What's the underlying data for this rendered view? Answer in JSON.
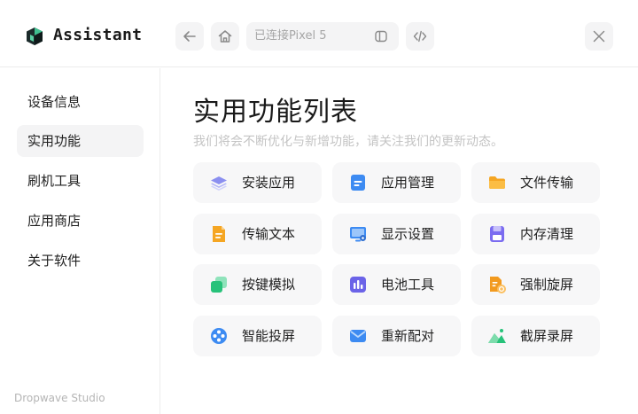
{
  "app": {
    "name": "Assistant",
    "device_status": "已连接Pixel 5",
    "footer": "Dropwave Studio"
  },
  "toolbar": {
    "back_icon": "arrow-left-icon",
    "home_icon": "home-icon",
    "device_panel_icon": "sidebar-panel-icon",
    "code_icon": "code-icon",
    "close_icon": "close-icon"
  },
  "sidebar": {
    "items": [
      {
        "label": "设备信息",
        "active": false
      },
      {
        "label": "实用功能",
        "active": true
      },
      {
        "label": "刷机工具",
        "active": false
      },
      {
        "label": "应用商店",
        "active": false
      },
      {
        "label": "关于软件",
        "active": false
      }
    ]
  },
  "main": {
    "title": "实用功能列表",
    "subtitle": "我们将会不断优化与新增功能，请关注我们的更新动态。",
    "features": [
      {
        "label": "安装应用",
        "icon": "layers-icon",
        "color": "#7b7fe6"
      },
      {
        "label": "应用管理",
        "icon": "app-manage-icon",
        "color": "#3d8bf2"
      },
      {
        "label": "文件传输",
        "icon": "folder-icon",
        "color": "#f7a623"
      },
      {
        "label": "传输文本",
        "icon": "document-icon",
        "color": "#f5a623"
      },
      {
        "label": "显示设置",
        "icon": "monitor-icon",
        "color": "#3d8bf2"
      },
      {
        "label": "内存清理",
        "icon": "floppy-icon",
        "color": "#7b6cf0"
      },
      {
        "label": "按键模拟",
        "icon": "keys-icon",
        "color": "#27c27a"
      },
      {
        "label": "电池工具",
        "icon": "battery-chart-icon",
        "color": "#6b63e8"
      },
      {
        "label": "强制旋屏",
        "icon": "rotate-file-icon",
        "color": "#f29a1f"
      },
      {
        "label": "智能投屏",
        "icon": "film-reel-icon",
        "color": "#3d8bf2"
      },
      {
        "label": "重新配对",
        "icon": "envelope-icon",
        "color": "#3d8bf2"
      },
      {
        "label": "截屏录屏",
        "icon": "landscape-icon",
        "color": "#27c27a"
      }
    ]
  }
}
